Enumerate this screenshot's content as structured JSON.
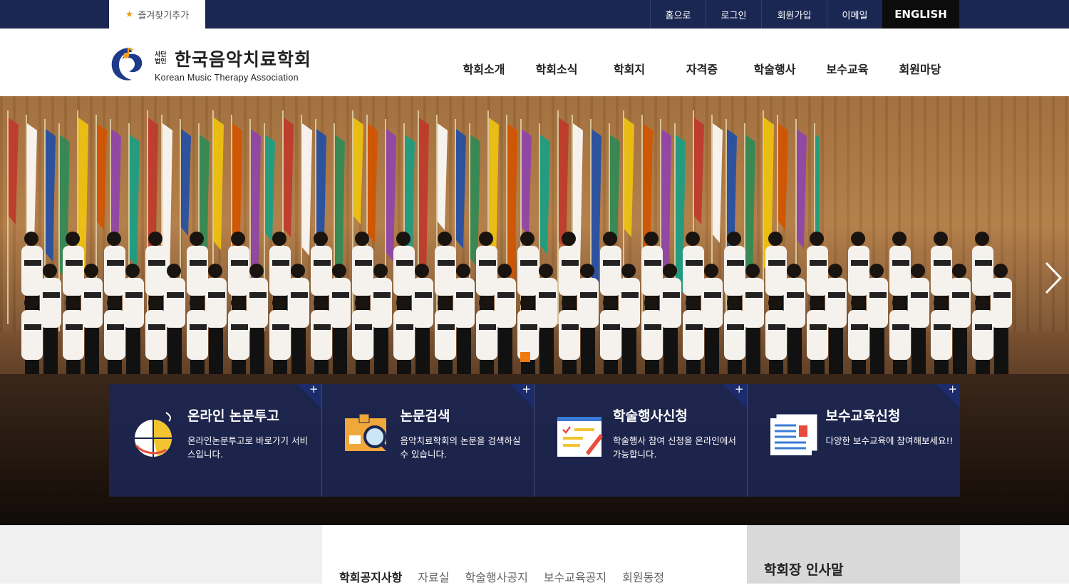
{
  "topbar": {
    "favorite_label": "즐겨찾기추가",
    "links": [
      "홈으로",
      "로그인",
      "회원가입",
      "이메일"
    ],
    "english_label": "ENGLISH"
  },
  "logo": {
    "small": "사단법인",
    "name": "한국음악치료학회",
    "english": "Korean Music Therapy Association"
  },
  "gnb": [
    "학회소개",
    "학회소식",
    "학회지",
    "자격증",
    "학술행사",
    "보수교육",
    "회원마당"
  ],
  "quick": [
    {
      "title": "온라인 논문투고",
      "desc": "온라인논문투고로 바로가기 서비스입니다.",
      "icon": "mouse-chart-icon"
    },
    {
      "title": "논문검색",
      "desc": "음악치료학회의 논문을 검색하실 수 있습니다.",
      "icon": "folder-search-icon"
    },
    {
      "title": "학술행사신청",
      "desc": "학술행사 참여 신청을 온라인에서 가능합니다.",
      "icon": "notepad-pen-icon"
    },
    {
      "title": "보수교육신청",
      "desc": "다양한 보수교육에 참여해보세요!!",
      "icon": "document-icon"
    }
  ],
  "board": {
    "tabs": [
      "학회공지사항",
      "자료실",
      "학술행사공지",
      "보수교육공지",
      "회원동정"
    ]
  },
  "greeting": {
    "title": "학회장 인사말"
  },
  "colors": {
    "navy": "#1b2753",
    "accent": "#f07a10"
  }
}
